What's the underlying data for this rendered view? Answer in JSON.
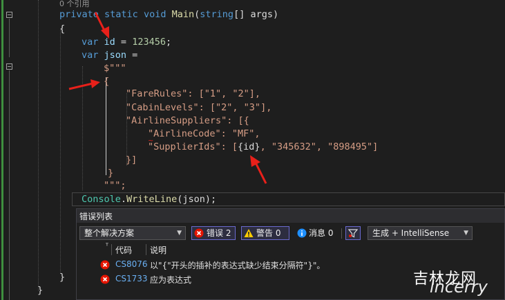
{
  "editor": {
    "reference_hint": "0 个引用",
    "lines": {
      "l1_kw1": "private",
      "l1_kw2": "static",
      "l1_kw3": "void",
      "l1_fn": "Main",
      "l1_open": "(",
      "l1_type": "string",
      "l1_rest": "[] args)",
      "l2": "{",
      "l3_kw": "var",
      "l3_var": "id",
      "l3_eq": " = ",
      "l3_num": "123456",
      "l3_end": ";",
      "l4_kw": "var",
      "l4_var": "json",
      "l4_eq": " =",
      "l5": "$\"\"\"",
      "l6": "{",
      "l7": "\"FareRules\": [\"1\", \"2\"],",
      "l8": "\"CabinLevels\": [\"2\", \"3\"],",
      "l9": "\"AirlineSuppliers\": [{",
      "l10": "\"AirlineCode\": \"MF\",",
      "l11a": "\"SupplierIds\": [",
      "l11b": "{id}",
      "l11c": ", \"345632\", \"898495\"]",
      "l12": "}]",
      "l13": "}",
      "l14": "\"\"\";",
      "l15_type": "Console",
      "l15_dot": ".",
      "l15_fn": "WriteLine",
      "l15_rest": "(json);",
      "l16": "}",
      "l17": "}"
    }
  },
  "error_list": {
    "title": "错误列表",
    "scope": "整个解决方案",
    "errors_label": "错误 2",
    "warnings_label": "警告 0",
    "messages_label": "消息 0",
    "build_filter": "生成 + IntelliSense",
    "columns": {
      "code": "代码",
      "description": "说明"
    },
    "rows": [
      {
        "code": "CS8076",
        "description": "以\"{\"开头的插补的表达式缺少结束分隔符\"}\"。"
      },
      {
        "code": "CS1733",
        "description": "应为表达式"
      }
    ]
  },
  "watermark": {
    "line1": "吉林龙网",
    "line2": "lncerry"
  },
  "colors": {
    "keyword": "#569cd6",
    "type": "#4ec9b0",
    "method": "#dcdcaa",
    "string": "#d69d85",
    "number": "#b5cea8",
    "variable": "#9cdcfe",
    "arrow": "#e8201a",
    "error": "#e51400"
  }
}
